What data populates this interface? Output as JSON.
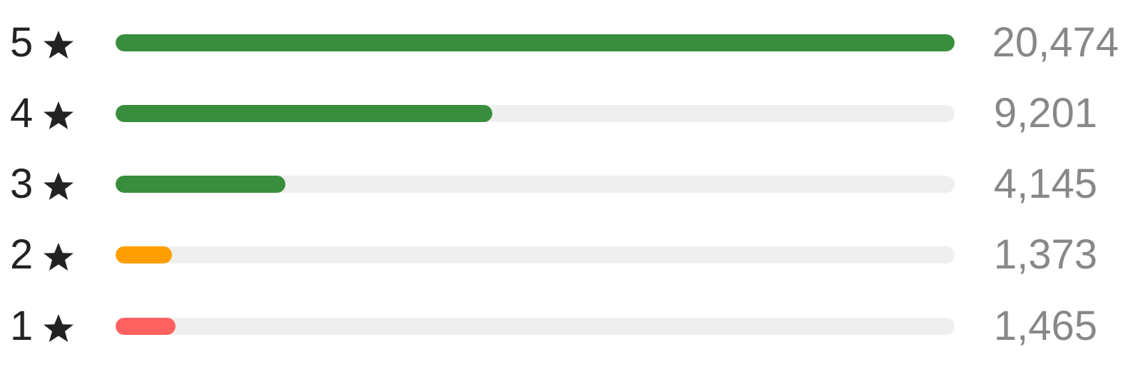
{
  "rating_distribution": {
    "rows": [
      {
        "stars": "5",
        "count": "20,474",
        "value": 20474,
        "color": "#388e3c"
      },
      {
        "stars": "4",
        "count": "9,201",
        "value": 9201,
        "color": "#388e3c"
      },
      {
        "stars": "3",
        "count": "4,145",
        "value": 4145,
        "color": "#388e3c"
      },
      {
        "stars": "2",
        "count": "1,373",
        "value": 1373,
        "color": "#ff9f00"
      },
      {
        "stars": "1",
        "count": "1,465",
        "value": 1465,
        "color": "#ff6161"
      }
    ],
    "icon": "star-icon",
    "track_color": "#efefef"
  }
}
